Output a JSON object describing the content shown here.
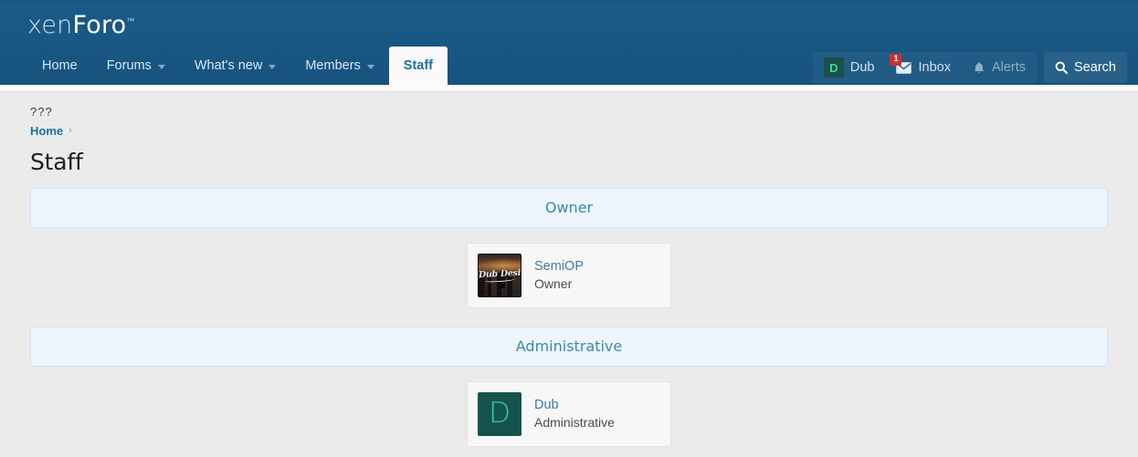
{
  "site": {
    "logo_part1": "xen",
    "logo_part2": "Foro",
    "logo_tm": "™"
  },
  "nav": {
    "tabs": [
      {
        "label": "Home",
        "has_caret": false,
        "active": false
      },
      {
        "label": "Forums",
        "has_caret": true,
        "active": false
      },
      {
        "label": "What's new",
        "has_caret": true,
        "active": false
      },
      {
        "label": "Members",
        "has_caret": true,
        "active": false
      },
      {
        "label": "Staff",
        "has_caret": false,
        "active": true
      }
    ],
    "user": {
      "avatar_letter": "D",
      "name": "Dub"
    },
    "inbox": {
      "label": "Inbox",
      "badge_count": "1",
      "icon": "envelope-icon"
    },
    "alerts": {
      "label": "Alerts",
      "icon": "bell-icon"
    },
    "search": {
      "label": "Search",
      "icon": "search-icon"
    }
  },
  "breadcrumb": {
    "missing_phrase": "???",
    "home_label": "Home",
    "separator": "›"
  },
  "page": {
    "title": "Staff"
  },
  "staff": {
    "sections": [
      {
        "heading": "Owner",
        "members": [
          {
            "name": "SemiOP",
            "title": "Owner",
            "avatar_type": "photo",
            "avatar_text": "Dub Designs"
          }
        ]
      },
      {
        "heading": "Administrative",
        "members": [
          {
            "name": "Dub",
            "title": "Administrative",
            "avatar_type": "letter",
            "avatar_letter": "D"
          }
        ]
      }
    ]
  },
  "colors": {
    "header_blue": "#185886",
    "link_blue": "#1d6fa5",
    "section_bg": "#eef5fd",
    "section_text": "#3d8aa8",
    "badge_red": "#cd2f2f",
    "avatar_teal": "#14544c",
    "avatar_teal_text": "#39c9b0",
    "page_bg": "#ebebeb"
  }
}
